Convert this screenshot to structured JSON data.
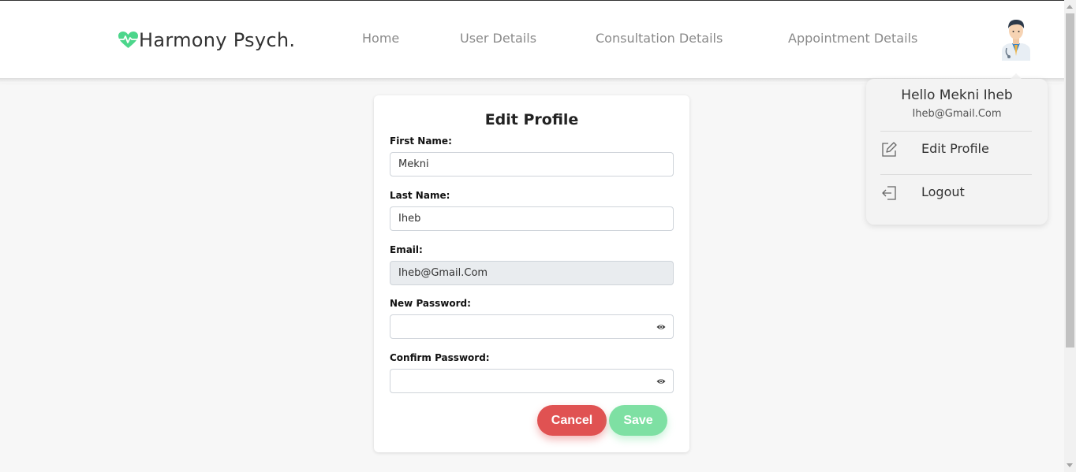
{
  "brand": {
    "name": "Harmony Psych.",
    "accent_color": "#4cd68b",
    "icon": "heart-pulse-icon"
  },
  "nav": {
    "links": [
      {
        "label": "Home"
      },
      {
        "label": "User Details"
      },
      {
        "label": "Consultation Details"
      },
      {
        "label": "Appointment Details"
      }
    ],
    "avatar_icon": "doctor-avatar-icon"
  },
  "profile_form": {
    "title": "Edit Profile",
    "fields": {
      "first_name": {
        "label": "First Name:",
        "value": "Mekni"
      },
      "last_name": {
        "label": "Last Name:",
        "value": "Iheb"
      },
      "email": {
        "label": "Email:",
        "value": "Iheb@Gmail.Com",
        "disabled": true
      },
      "new_password": {
        "label": "New Password:",
        "value": "",
        "icon": "eye-icon"
      },
      "confirm_password": {
        "label": "Confirm Password:",
        "value": "",
        "icon": "eye-icon"
      }
    },
    "buttons": {
      "cancel_label": "Cancel",
      "cancel_color": "#e05252",
      "save_label": "Save",
      "save_color": "#7ee0a3"
    }
  },
  "user_menu": {
    "greeting": "Hello Mekni Iheb",
    "email": "Iheb@Gmail.Com",
    "items": [
      {
        "label": "Edit Profile",
        "icon": "edit-icon"
      },
      {
        "label": "Logout",
        "icon": "logout-icon"
      }
    ]
  }
}
